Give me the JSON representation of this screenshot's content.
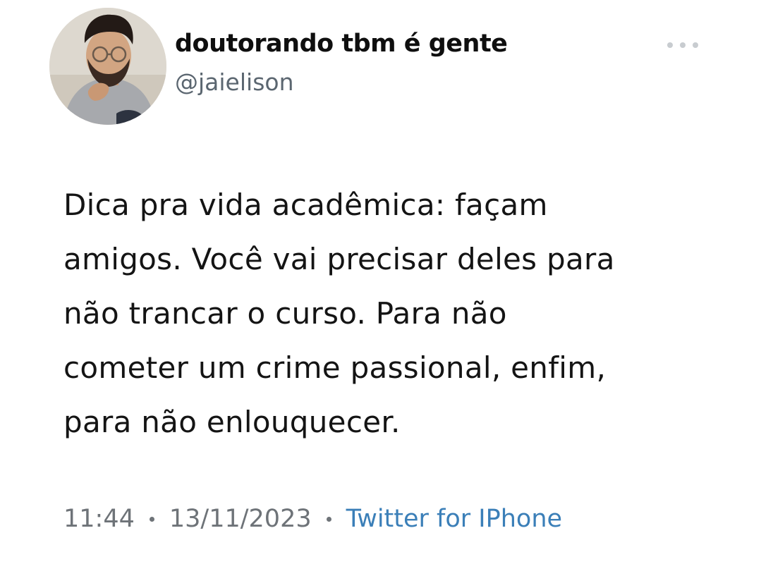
{
  "author": {
    "display_name": "doutorando tbm é gente",
    "handle": "@jaielison",
    "avatar_icon": "user-avatar-photo"
  },
  "actions": {
    "more_icon": "more-horizontal-icon"
  },
  "tweet": {
    "lines": [
      "Dica pra vida acadêmica: façam",
      "amigos. Você vai precisar deles para",
      "não trancar o curso. Para não",
      "cometer um crime passional, enfim,",
      "para não enlouquecer."
    ],
    "time": "11:44",
    "date": "13/11/2023",
    "source": "Twitter for IPhone"
  },
  "colors": {
    "background": "#ffffff",
    "text": "#141414",
    "muted": "#6e7378",
    "link": "#3b7fb8"
  }
}
